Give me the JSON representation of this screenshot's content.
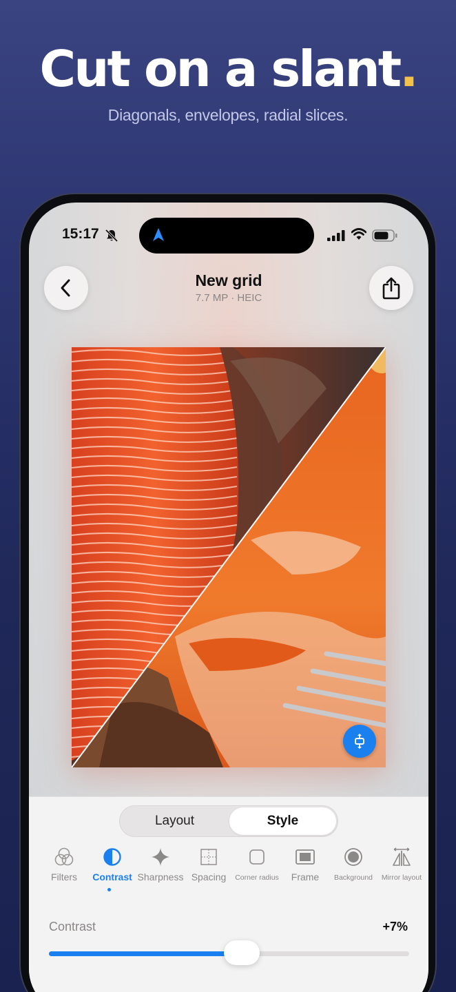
{
  "promo": {
    "title": "Cut on a slant",
    "title_dot": ".",
    "subtitle": "Diagonals, envelopes, radial slices."
  },
  "status_bar": {
    "time": "15:17",
    "icons": [
      "bell-slash-icon",
      "navigation-arrow-icon",
      "signal-icon",
      "wifi-icon",
      "battery-icon"
    ]
  },
  "header": {
    "title": "New grid",
    "meta": "7.7 MP · HEIC",
    "back_icon": "chevron-left-icon",
    "share_icon": "share-icon"
  },
  "canvas": {
    "images": [
      "salmon fillet raw",
      "smoked salmon with fork"
    ],
    "split": "diagonal",
    "fab_icon": "swap-vertical-icon"
  },
  "panel": {
    "tabs": [
      {
        "label": "Layout",
        "selected": false
      },
      {
        "label": "Style",
        "selected": true
      }
    ],
    "tools": [
      {
        "label": "Filters",
        "icon": "filters-icon",
        "active": false
      },
      {
        "label": "Contrast",
        "icon": "contrast-icon",
        "active": true
      },
      {
        "label": "Sharpness",
        "icon": "sparkle-icon",
        "active": false
      },
      {
        "label": "Spacing",
        "icon": "spacing-icon",
        "active": false
      },
      {
        "label": "Corner radius",
        "icon": "corner-radius-icon",
        "active": false
      },
      {
        "label": "Frame",
        "icon": "frame-icon",
        "active": false
      },
      {
        "label": "Background",
        "icon": "background-icon",
        "active": false
      },
      {
        "label": "Mirror layout",
        "icon": "mirror-icon",
        "active": false
      }
    ],
    "slider": {
      "label": "Contrast",
      "value_text": "+7%",
      "fraction": 0.535
    }
  },
  "colors": {
    "accent": "#1a80f0",
    "promo_dot": "#f3c24a"
  }
}
